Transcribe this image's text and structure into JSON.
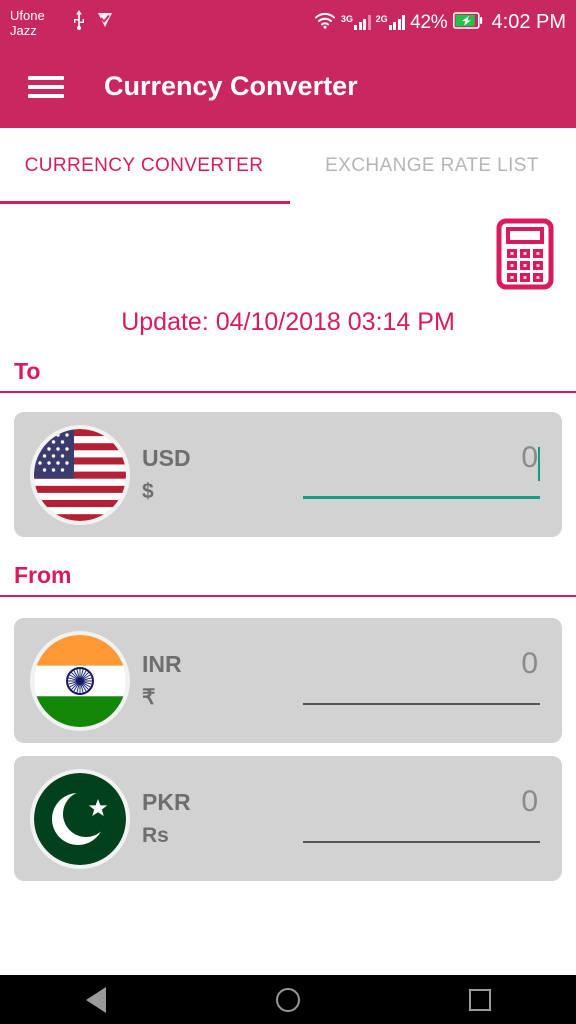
{
  "status_bar": {
    "carrier_1": "Ufone",
    "carrier_2": "Jazz",
    "usb_icon": "usb-icon",
    "media_icon": "media-play-icon",
    "wifi_icon": "wifi-icon",
    "network_1_label": "3G",
    "network_2_label": "2G",
    "battery_percent": "42%",
    "battery_icon": "battery-charging-icon",
    "clock": "4:02 PM",
    "background_color": "#c9275f"
  },
  "app_bar": {
    "menu_icon": "hamburger-menu-icon",
    "title": "Currency Converter",
    "background_color": "#c9275f"
  },
  "tabs": [
    {
      "label": "CURRENCY CONVERTER",
      "active": true
    },
    {
      "label": "EXCHANGE RATE LIST",
      "active": false
    }
  ],
  "toolbar": {
    "calculator_icon": "calculator-icon",
    "calculator_color": "#d81b60"
  },
  "update": {
    "text": "Update: 04/10/2018 03:14 PM",
    "color": "#d81b60"
  },
  "sections": {
    "to": {
      "label": "To",
      "rows": [
        {
          "code": "USD",
          "symbol": "$",
          "flag": "flag-usa-icon",
          "value": "0",
          "placeholder": "0",
          "focused": true,
          "underline_color": "#179b85"
        }
      ]
    },
    "from": {
      "label": "From",
      "rows": [
        {
          "code": "INR",
          "symbol": "₹",
          "flag": "flag-india-icon",
          "value": "0",
          "placeholder": "0",
          "focused": false,
          "underline_color": "#555555"
        },
        {
          "code": "PKR",
          "symbol": "Rs",
          "flag": "flag-pakistan-icon",
          "value": "0",
          "placeholder": "0",
          "focused": false,
          "underline_color": "#555555"
        }
      ]
    }
  },
  "nav_bar": {
    "back_icon": "back-triangle-icon",
    "home_icon": "home-circle-icon",
    "recents_icon": "recents-square-icon"
  },
  "theme": {
    "primary": "#c9275f",
    "accent": "#d81b60",
    "card_background": "#d2d2d2",
    "focused_underline": "#179b85",
    "muted_text": "#8a8a8a"
  }
}
